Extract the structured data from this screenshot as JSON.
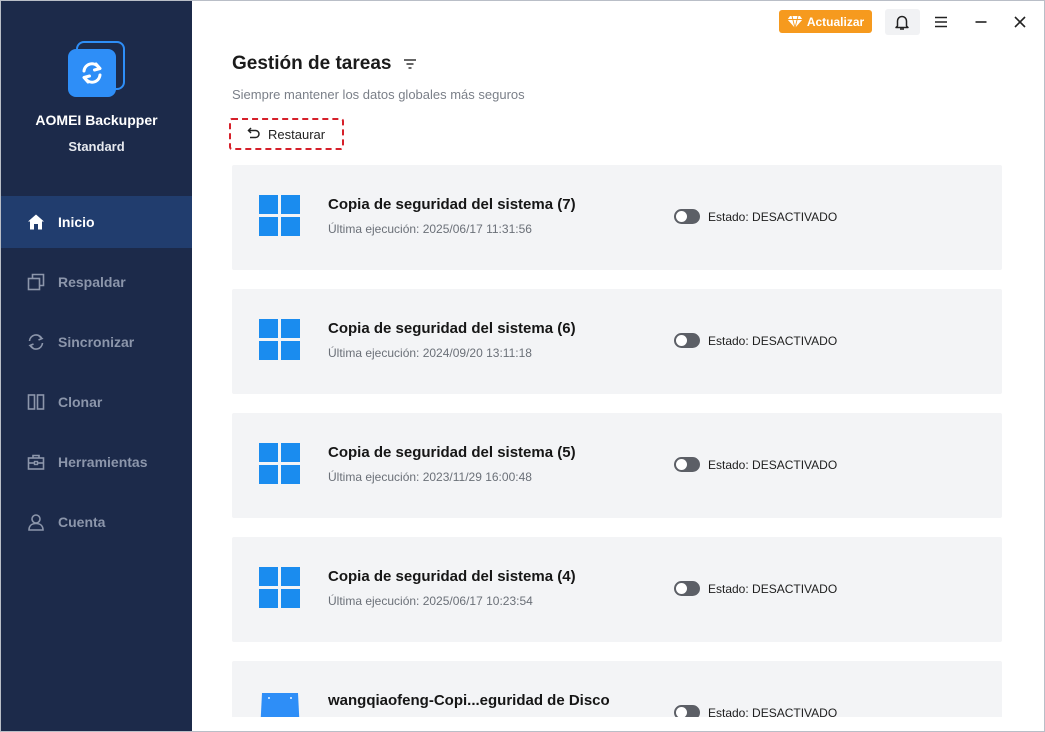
{
  "app": {
    "name": "AOMEI Backupper",
    "edition": "Standard"
  },
  "sidebar": {
    "items": [
      {
        "label": "Inicio",
        "icon": "home-icon",
        "active": true
      },
      {
        "label": "Respaldar",
        "icon": "backup-icon",
        "active": false
      },
      {
        "label": "Sincronizar",
        "icon": "sync-icon",
        "active": false
      },
      {
        "label": "Clonar",
        "icon": "clone-icon",
        "active": false
      },
      {
        "label": "Herramientas",
        "icon": "toolbox-icon",
        "active": false
      },
      {
        "label": "Cuenta",
        "icon": "user-icon",
        "active": false
      }
    ]
  },
  "titlebar": {
    "upgrade_label": "Actualizar",
    "icons": [
      "bell-icon",
      "menu-icon",
      "minimize-icon",
      "close-icon"
    ]
  },
  "main": {
    "title": "Gestión de tareas",
    "subtitle": "Siempre mantener los datos globales más seguros",
    "restore_label": "Restaurar",
    "tasks": [
      {
        "name": "Copia de seguridad del sistema (7)",
        "last_run": "Última ejecución: 2025/06/17 11:31:56",
        "status": "Estado: DESACTIVADO",
        "icon": "windows-icon"
      },
      {
        "name": "Copia de seguridad del sistema (6)",
        "last_run": "Última ejecución: 2024/09/20 13:11:18",
        "status": "Estado: DESACTIVADO",
        "icon": "windows-icon"
      },
      {
        "name": "Copia de seguridad del sistema (5)",
        "last_run": "Última ejecución: 2023/11/29 16:00:48",
        "status": "Estado: DESACTIVADO",
        "icon": "windows-icon"
      },
      {
        "name": "Copia de seguridad del sistema (4)",
        "last_run": "Última ejecución: 2025/06/17 10:23:54",
        "status": "Estado: DESACTIVADO",
        "icon": "windows-icon"
      },
      {
        "name": "wangqiaofeng-Copi...eguridad de Disco",
        "last_run": "",
        "status": "Estado: DESACTIVADO",
        "icon": "disk-icon"
      }
    ]
  },
  "colors": {
    "sidebar_bg": "#1c2a4a",
    "sidebar_active": "#213d6e",
    "accent": "#2e8ef7",
    "upgrade": "#f69a1e",
    "highlight_border": "#d6202a"
  }
}
